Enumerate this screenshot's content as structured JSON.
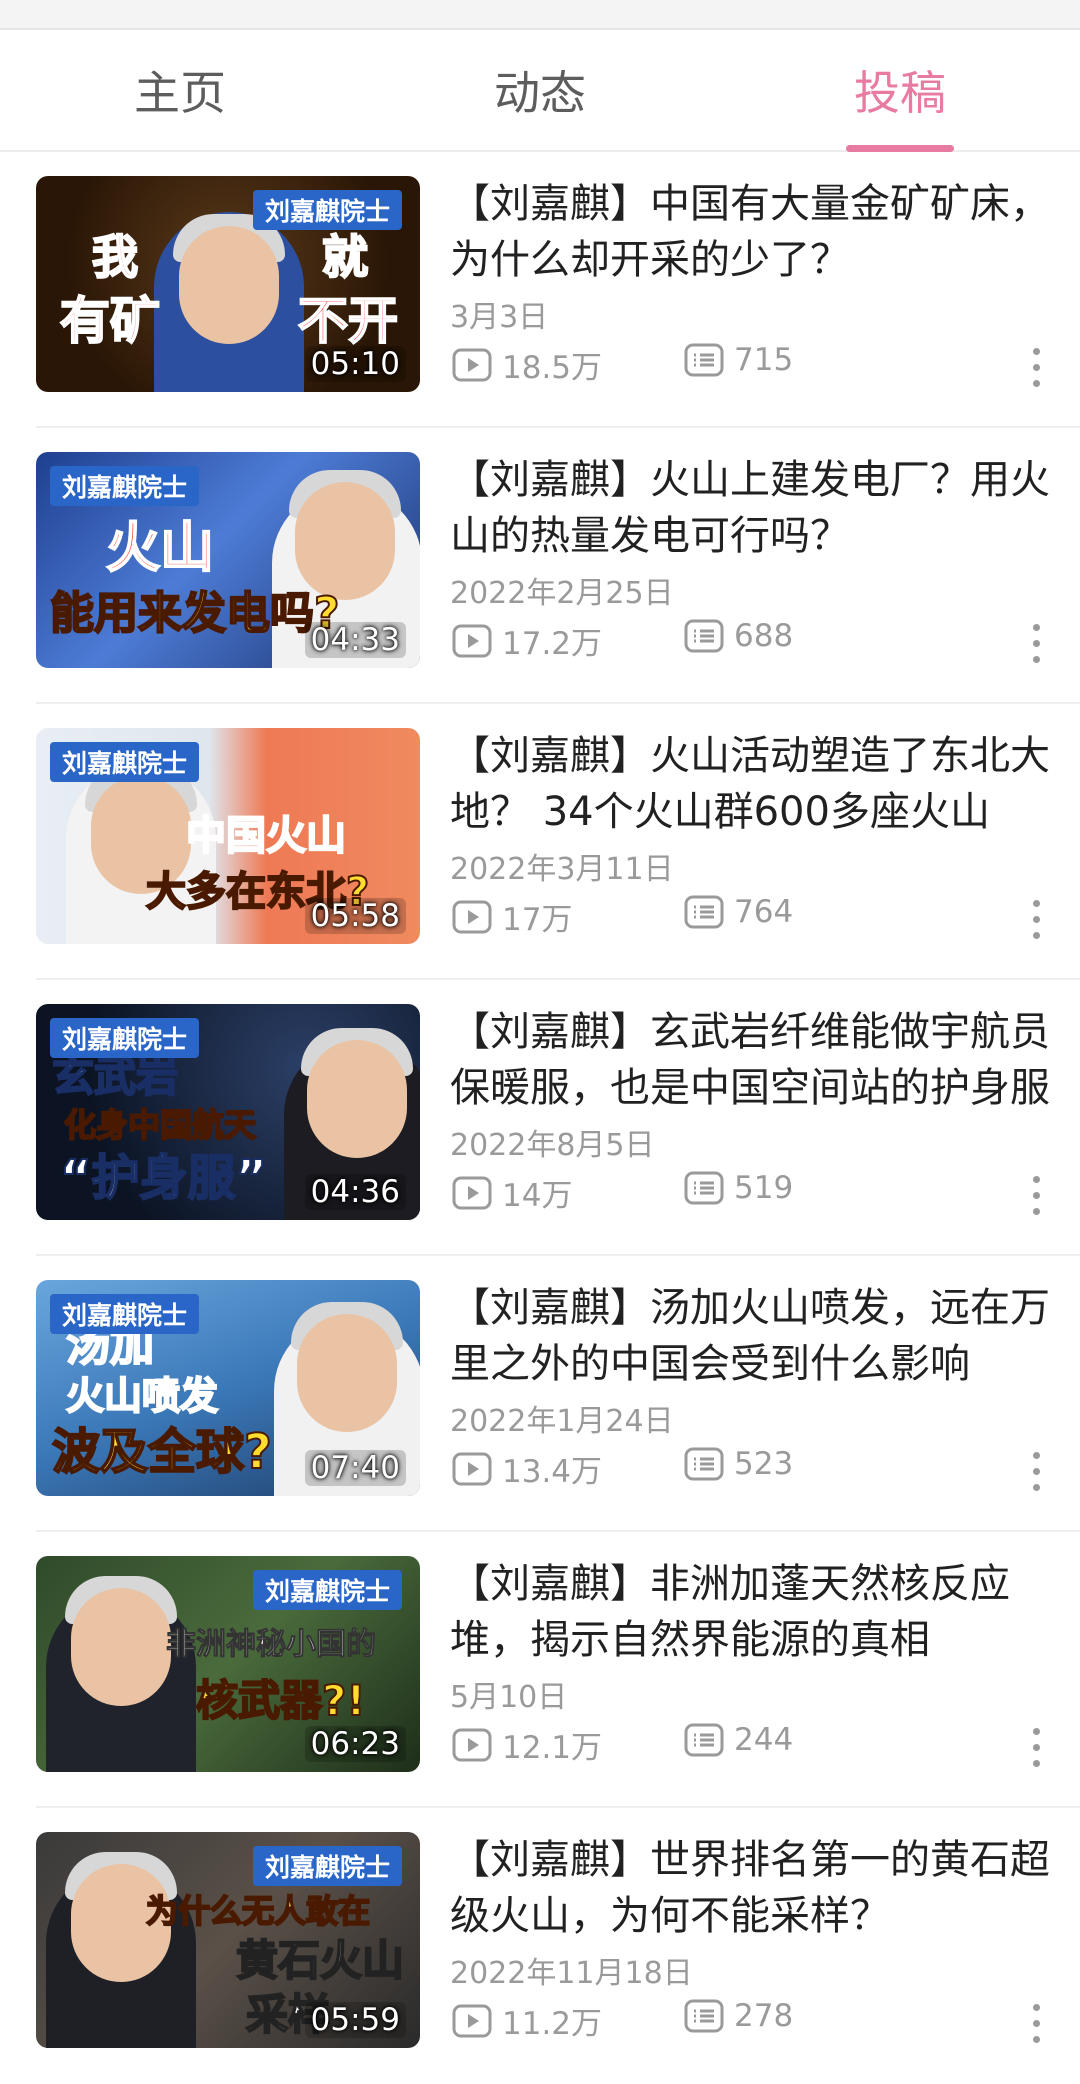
{
  "tabs": [
    {
      "label": "主页",
      "active": false
    },
    {
      "label": "动态",
      "active": false
    },
    {
      "label": "投稿",
      "active": true
    }
  ],
  "accent_color": "#e87ba1",
  "videos": [
    {
      "title": "【刘嘉麒】中国有大量金矿矿床，为什么却开采的少了？",
      "date": "3月3日",
      "views": "18.5万",
      "comments": "715",
      "duration": "05:10",
      "badge": "刘嘉麒院士",
      "overlay_lines": [
        "我",
        "就",
        "有矿",
        "不开"
      ]
    },
    {
      "title": "【刘嘉麒】火山上建发电厂？用火山的热量发电可行吗？",
      "date": "2022年2月25日",
      "views": "17.2万",
      "comments": "688",
      "duration": "04:33",
      "badge": "刘嘉麒院士",
      "overlay_lines": [
        "火山",
        "能用来发电吗?"
      ]
    },
    {
      "title": "【刘嘉麒】火山活动塑造了东北大地？ 34个火山群600多座火山",
      "date": "2022年3月11日",
      "views": "17万",
      "comments": "764",
      "duration": "05:58",
      "badge": "刘嘉麒院士",
      "overlay_lines": [
        "中国火山",
        "大多在东北?"
      ]
    },
    {
      "title": "【刘嘉麒】玄武岩纤维能做宇航员保暖服，也是中国空间站的护身服",
      "date": "2022年8月5日",
      "views": "14万",
      "comments": "519",
      "duration": "04:36",
      "badge": "刘嘉麒院士",
      "overlay_lines": [
        "玄武岩",
        "化身中国航天",
        "“护身服”"
      ]
    },
    {
      "title": "【刘嘉麒】汤加火山喷发，远在万里之外的中国会受到什么影响",
      "date": "2022年1月24日",
      "views": "13.4万",
      "comments": "523",
      "duration": "07:40",
      "badge": "刘嘉麒院士",
      "overlay_lines": [
        "汤加",
        "火山喷发",
        "波及全球?"
      ]
    },
    {
      "title": "【刘嘉麒】非洲加蓬天然核反应堆，揭示自然界能源的真相",
      "date": "5月10日",
      "views": "12.1万",
      "comments": "244",
      "duration": "06:23",
      "badge": "刘嘉麒院士",
      "overlay_lines": [
        "非洲神秘小国的",
        "核武器?!"
      ]
    },
    {
      "title": "【刘嘉麒】世界排名第一的黄石超级火山，为何不能采样？",
      "date": "2022年11月18日",
      "views": "11.2万",
      "comments": "278",
      "duration": "05:59",
      "badge": "刘嘉麒院士",
      "overlay_lines": [
        "为什么无人敢在",
        "黄石火山",
        "采样"
      ]
    }
  ]
}
